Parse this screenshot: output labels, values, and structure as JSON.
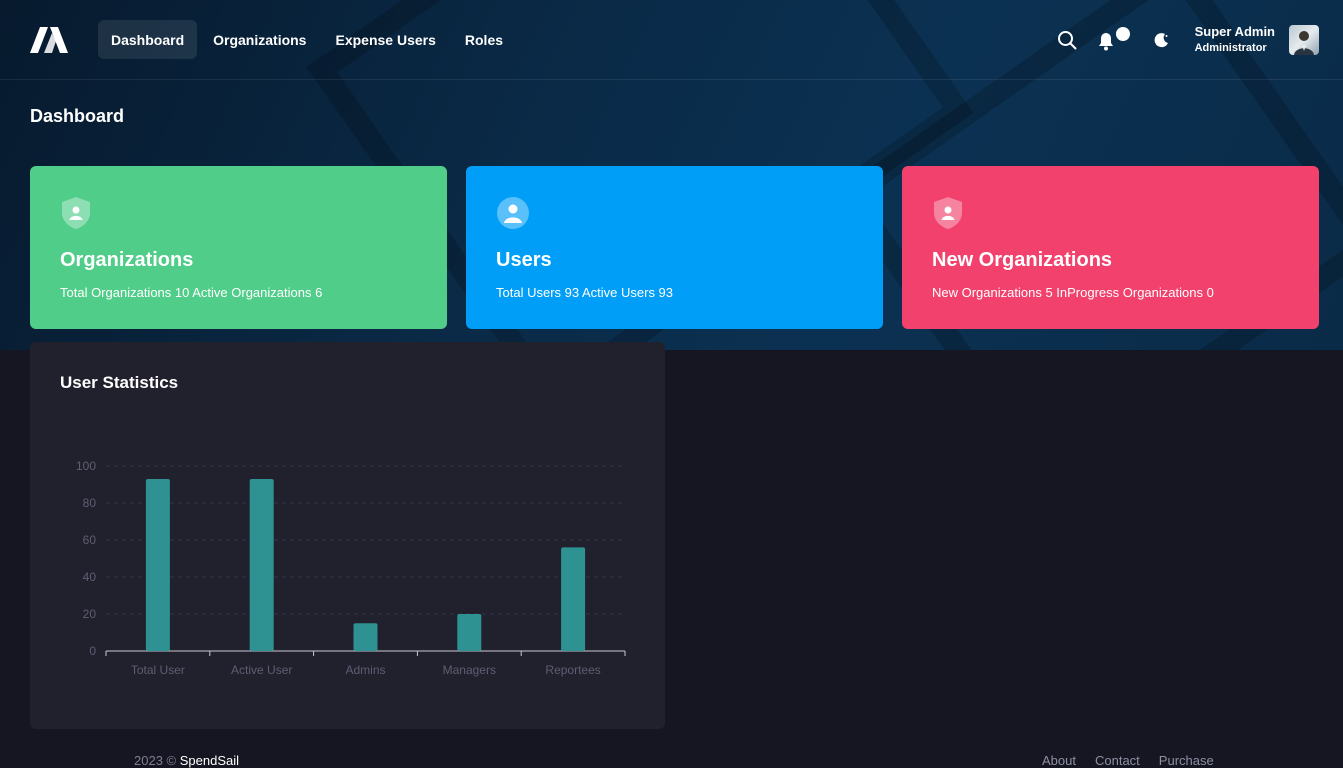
{
  "nav": {
    "items": [
      {
        "label": "Dashboard",
        "active": true
      },
      {
        "label": "Organizations",
        "active": false
      },
      {
        "label": "Expense Users",
        "active": false
      },
      {
        "label": "Roles",
        "active": false
      }
    ]
  },
  "user": {
    "name": "Super Admin",
    "role": "Administrator"
  },
  "page": {
    "title": "Dashboard"
  },
  "cards": [
    {
      "title": "Organizations",
      "subtitle": "Total Organizations 10 Active Organizations 6",
      "color": "#50cd89",
      "icon": "shield-user-icon"
    },
    {
      "title": "Users",
      "subtitle": "Total Users 93 Active Users 93",
      "color": "#009ef7",
      "icon": "user-circle-icon"
    },
    {
      "title": "New Organizations",
      "subtitle": "New Organizations 5 InProgress Organizations 0",
      "color": "#f1416c",
      "icon": "shield-user-icon"
    }
  ],
  "stats": {
    "title": "User Statistics"
  },
  "chart_data": {
    "type": "bar",
    "categories": [
      "Total User",
      "Active User",
      "Admins",
      "Managers",
      "Reportees"
    ],
    "values": [
      93,
      93,
      15,
      20,
      56
    ],
    "ylim": [
      0,
      100
    ],
    "yticks": [
      0,
      20,
      40,
      60,
      80,
      100
    ],
    "grid": true,
    "bar_color": "#2e9192"
  },
  "footer": {
    "year": "2023 ©",
    "brand": "SpendSail",
    "links": [
      "About",
      "Contact",
      "Purchase"
    ]
  }
}
